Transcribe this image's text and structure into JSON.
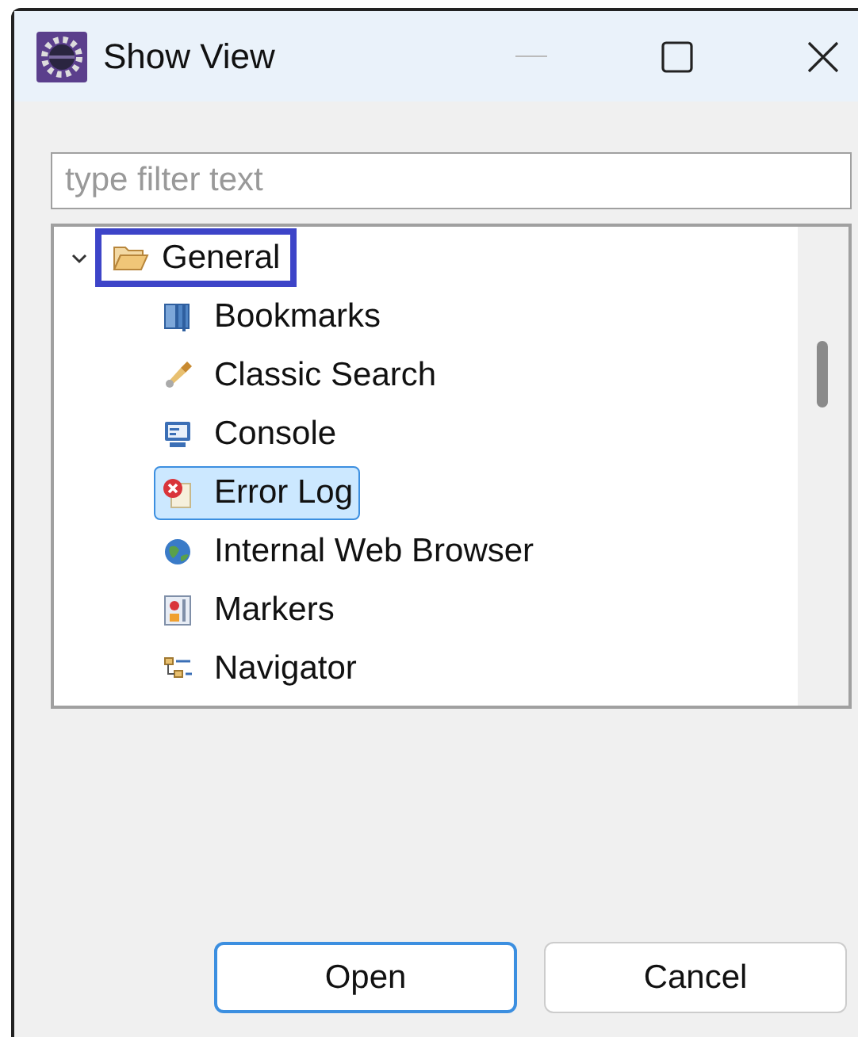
{
  "window": {
    "title": "Show View"
  },
  "filter": {
    "placeholder": "type filter text"
  },
  "tree": [
    {
      "label": "General",
      "expanded": true,
      "selected": false,
      "outlined": true,
      "children": [
        {
          "label": "Bookmarks",
          "selected": false
        },
        {
          "label": "Classic Search",
          "selected": false
        },
        {
          "label": "Console",
          "selected": false
        },
        {
          "label": "Error Log",
          "selected": true
        },
        {
          "label": "Internal Web Browser",
          "selected": false
        },
        {
          "label": "Markers",
          "selected": false
        },
        {
          "label": "Navigator",
          "selected": false
        }
      ]
    }
  ],
  "buttons": [
    {
      "label": "Open",
      "default": true
    },
    {
      "label": "Cancel",
      "default": false
    }
  ]
}
